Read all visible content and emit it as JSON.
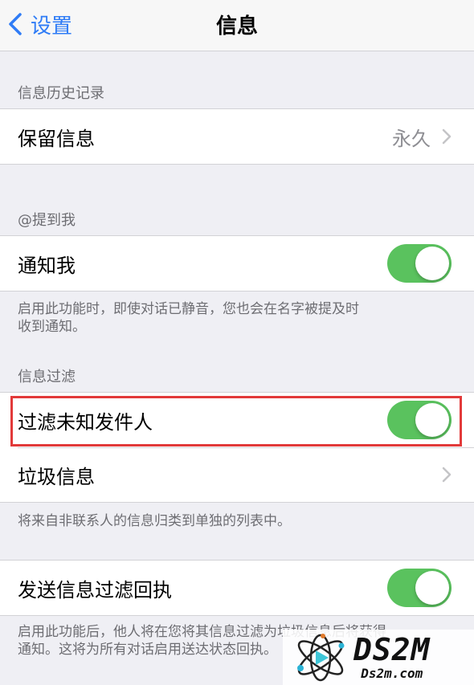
{
  "navbar": {
    "back_label": "设置",
    "title": "信息"
  },
  "history": {
    "header": "信息历史记录",
    "keep_label": "保留信息",
    "keep_value": "永久"
  },
  "mention": {
    "header": "@提到我",
    "notify_label": "通知我",
    "notify_on": true,
    "footer_line1": "启用此功能时，即使对话已静音，您也会在名字被提及时",
    "footer_line2": "收到通知。"
  },
  "filter": {
    "header": "信息过滤",
    "unknown_label": "过滤未知发件人",
    "unknown_on": true,
    "junk_label": "垃圾信息",
    "footer": "将来自非联系人的信息归类到单独的列表中。"
  },
  "receipt": {
    "label": "发送信息过滤回执",
    "on": true,
    "footer_line1": "启用此功能后，他人将在您将其信息过滤为垃圾信息后将获得",
    "footer_line2": "通知。这将为所有对话启用送达状态回执。"
  },
  "watermark": {
    "brand": "DS2M",
    "site": "Ds2m.com"
  },
  "colors": {
    "accent": "#2f7cf6",
    "toggle_on": "#5ac25e",
    "highlight": "#e23a3a"
  }
}
